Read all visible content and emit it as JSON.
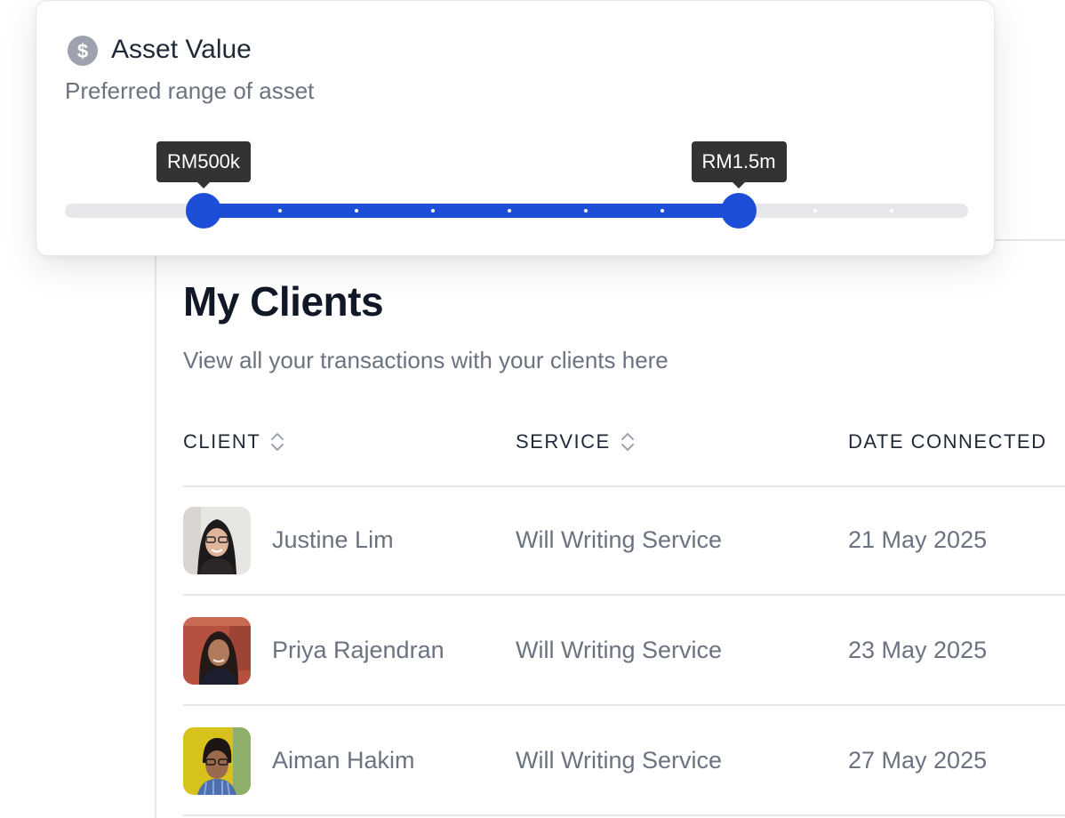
{
  "asset_filter": {
    "title": "Asset Value",
    "subtitle": "Preferred range of asset",
    "icon": "dollar-circle-icon",
    "range_min_label": "RM500k",
    "range_max_label": "RM1.5m",
    "steps_total": 10,
    "min_step": 1,
    "max_step": 8,
    "accent_color": "#1d4ed8"
  },
  "page": {
    "title": "My Clients",
    "subtitle": "View all your transactions with your clients here"
  },
  "table": {
    "columns": [
      {
        "label": "CLIENT",
        "sortable": true
      },
      {
        "label": "SERVICE",
        "sortable": true
      },
      {
        "label": "DATE CONNECTED",
        "sortable": false
      }
    ],
    "rows": [
      {
        "client": "Justine Lim",
        "service": "Will Writing Service",
        "date": "21 May 2025"
      },
      {
        "client": "Priya Rajendran",
        "service": "Will Writing Service",
        "date": "23 May 2025"
      },
      {
        "client": "Aiman Hakim",
        "service": "Will Writing Service",
        "date": "27 May 2025"
      }
    ]
  }
}
